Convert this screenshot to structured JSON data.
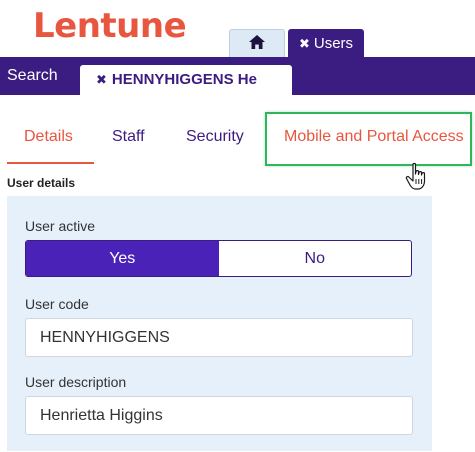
{
  "brand": {
    "logo_text": "Lentune",
    "accent_color": "#e8563f",
    "nav_color": "#3b1c80"
  },
  "top_tabs": {
    "home_icon": "home-icon",
    "users_label": "Users",
    "close_icon": "close-icon"
  },
  "navbar": {
    "search_label": "Search",
    "record_tab_label": "HENNYHIGGENS He"
  },
  "subtabs": [
    {
      "label": "Details",
      "active": true
    },
    {
      "label": "Staff",
      "active": false
    },
    {
      "label": "Security",
      "active": false
    },
    {
      "label": "Mobile and Portal Access",
      "active": false,
      "hovered": true
    }
  ],
  "user_details": {
    "section_title": "User details",
    "user_active_label": "User active",
    "toggle_options": [
      "Yes",
      "No"
    ],
    "toggle_selected": "Yes",
    "user_code_label": "User code",
    "user_code_value": "HENNYHIGGENS",
    "user_description_label": "User description",
    "user_description_value": "Henrietta Higgins"
  }
}
